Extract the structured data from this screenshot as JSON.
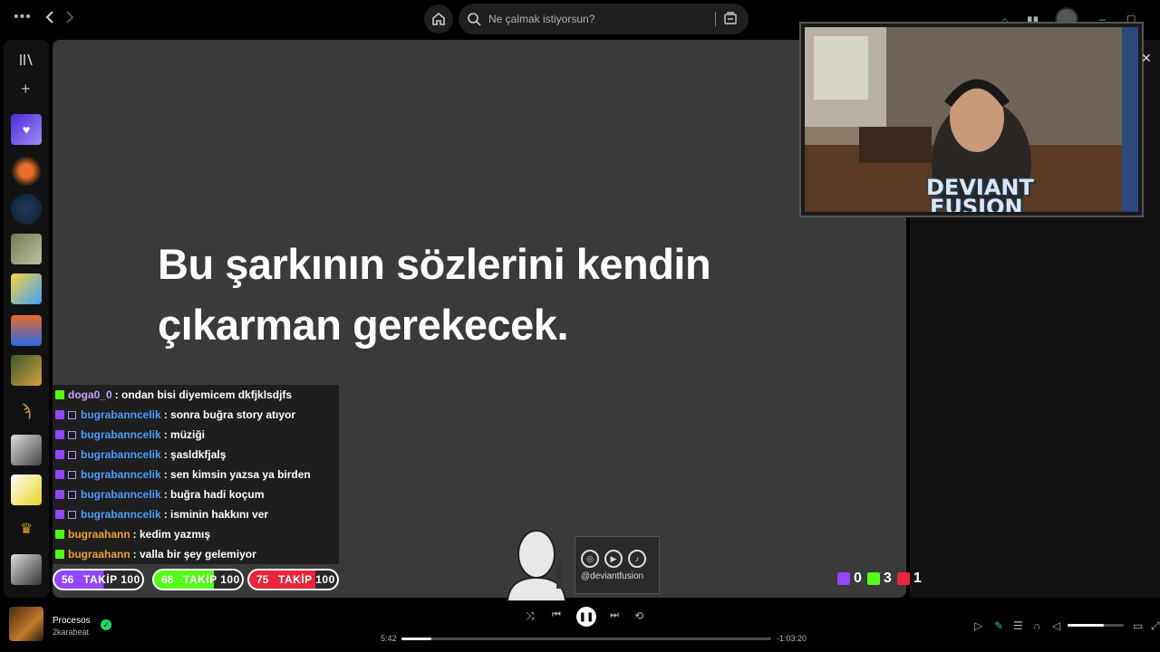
{
  "search": {
    "placeholder": "Ne çalmak istiyorsun?"
  },
  "lyrics": {
    "message_line1": "Bu şarkının sözlerini kendin",
    "message_line2": "çıkarman gerekecek."
  },
  "chat": [
    {
      "platform": "kick",
      "user": "doga0_0",
      "user_color": "#c7a2ff",
      "text": ": ondan bisi diyemicem dkfjklsdjfs"
    },
    {
      "platform": "twitch",
      "user": "bugrabanncelik",
      "user_color": "#4a9dff",
      "text": ": sonra buğra story atıyor"
    },
    {
      "platform": "twitch",
      "user": "bugrabanncelik",
      "user_color": "#4a9dff",
      "text": ": müziği"
    },
    {
      "platform": "twitch",
      "user": "bugrabanncelik",
      "user_color": "#4a9dff",
      "text": ": şasldkfjalş"
    },
    {
      "platform": "twitch",
      "user": "bugrabanncelik",
      "user_color": "#4a9dff",
      "text": ": sen kimsin yazsa ya birden"
    },
    {
      "platform": "twitch",
      "user": "bugrabanncelik",
      "user_color": "#4a9dff",
      "text": ": buğra hadi koçum"
    },
    {
      "platform": "twitch",
      "user": "bugrabanncelik",
      "user_color": "#4a9dff",
      "text": ": isminin hakkını ver"
    },
    {
      "platform": "kick",
      "user": "bugraahann",
      "user_color": "#f0a030",
      "text": ": kedim yazmış"
    },
    {
      "platform": "kick",
      "user": "bugraahann",
      "user_color": "#f0a030",
      "text": ": valla bir şey gelemiyor"
    }
  ],
  "goals": [
    {
      "current": "56",
      "label": "TAKİP 100",
      "color": "#9146ff",
      "progress": 0.56
    },
    {
      "current": "68",
      "label": "TAKİP 100",
      "color": "#53fc18",
      "progress": 0.68
    },
    {
      "current": "75",
      "label": "TAKİP 100",
      "color": "#e8253a",
      "progress": 0.75
    }
  ],
  "social": {
    "handle": "@deviantfusion",
    "icons": [
      "instagram-icon",
      "youtube-icon",
      "tiktok-icon"
    ]
  },
  "webcam": {
    "logo_line1": "DEVIANT",
    "logo_line2": "FUSION"
  },
  "viewers": {
    "twitch": "0",
    "kick": "3",
    "youtube": "1"
  },
  "now_playing": {
    "title": "Procesos",
    "artist": "2karabeat",
    "elapsed": "5:42",
    "remaining": "-1:03:20",
    "progress": 0.08,
    "volume": 0.65
  },
  "colors": {
    "accent": "#1ed760",
    "kick": "#53fc18",
    "twitch": "#9146ff",
    "youtube": "#e8253a"
  }
}
